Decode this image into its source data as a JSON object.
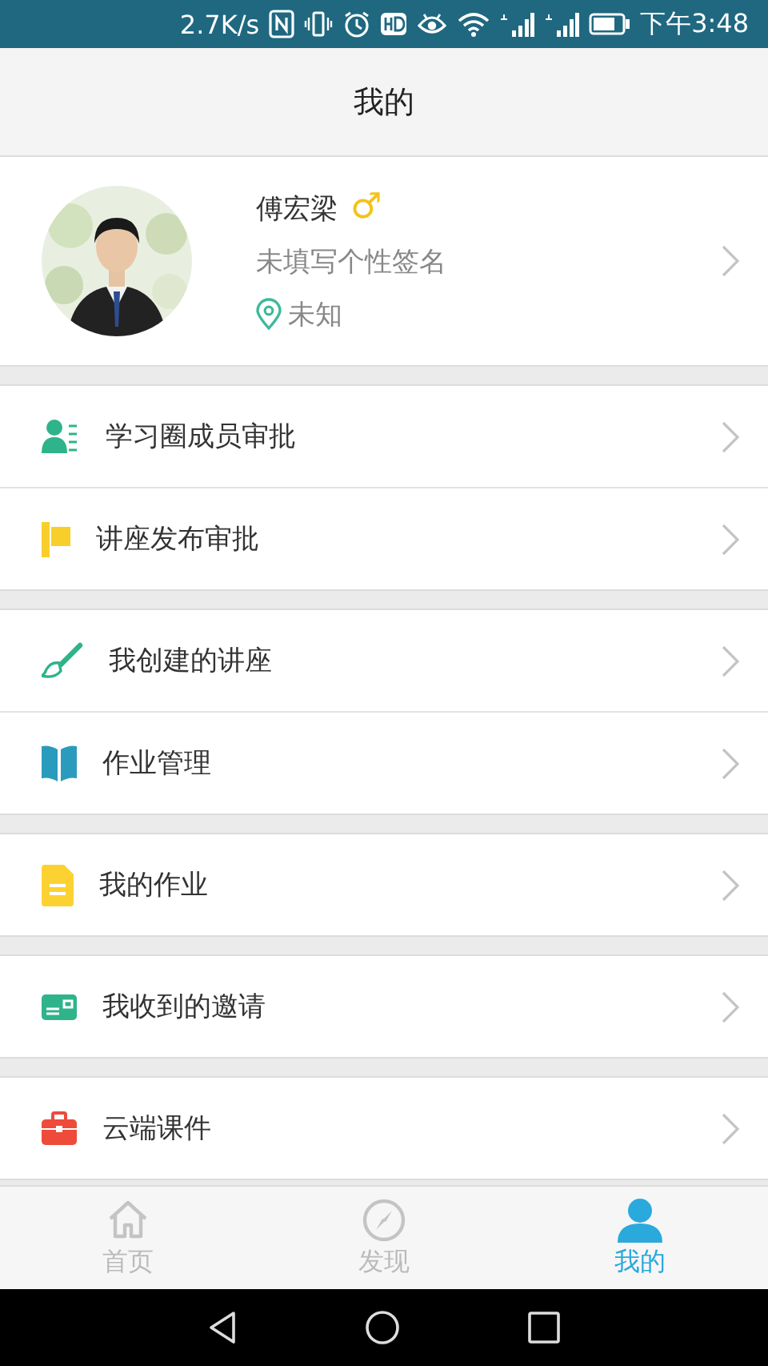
{
  "status_bar": {
    "speed": "2.7K/s",
    "time": "下午3:48"
  },
  "header": {
    "title": "我的"
  },
  "profile": {
    "name": "傅宏梁",
    "gender_symbol": "♂",
    "signature": "未填写个性签名",
    "location": "未知"
  },
  "menu_groups": [
    {
      "items": [
        {
          "label": "学习圈成员审批"
        },
        {
          "label": "讲座发布审批"
        }
      ]
    },
    {
      "items": [
        {
          "label": "我创建的讲座"
        },
        {
          "label": "作业管理"
        }
      ]
    },
    {
      "items": [
        {
          "label": "我的作业"
        }
      ]
    },
    {
      "items": [
        {
          "label": "我收到的邀请"
        }
      ]
    },
    {
      "items": [
        {
          "label": "云端课件"
        }
      ]
    }
  ],
  "tab_bar": [
    {
      "label": "首页",
      "selected": false
    },
    {
      "label": "发现",
      "selected": false
    },
    {
      "label": "我的",
      "selected": true
    }
  ]
}
